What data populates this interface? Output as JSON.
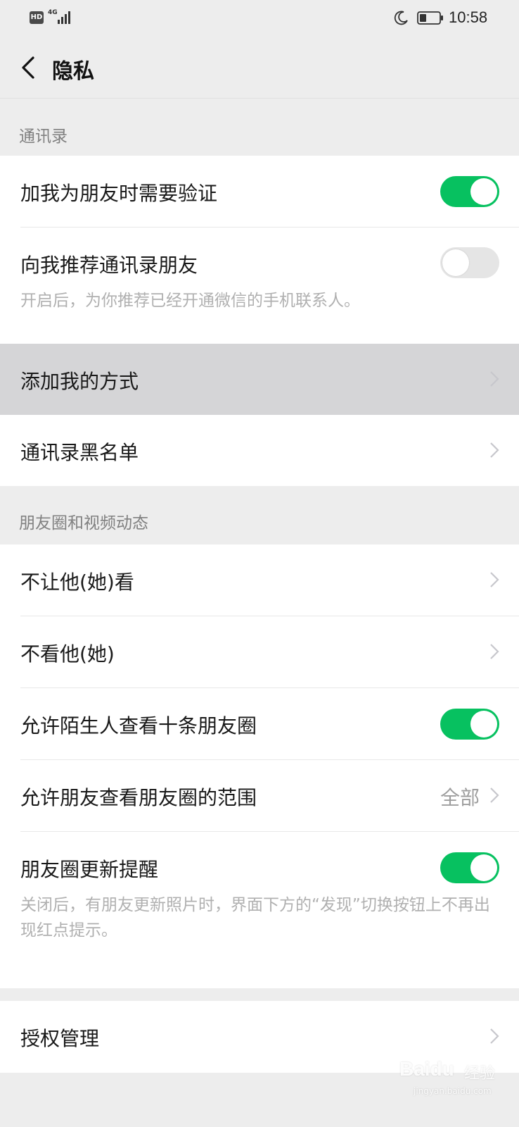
{
  "status_bar": {
    "hd": "HD",
    "network": "4G",
    "time": "10:58"
  },
  "navbar": {
    "title": "隐私",
    "back_icon": "chevron-left-icon"
  },
  "sections": {
    "contacts": {
      "header": "通讯录",
      "items": [
        {
          "label": "加我为朋友时需要验证",
          "toggle": "on"
        },
        {
          "label": "向我推荐通讯录朋友",
          "toggle": "off",
          "description": "开启后，为你推荐已经开通微信的手机联系人。"
        },
        {
          "label": "添加我的方式"
        },
        {
          "label": "通讯录黑名单"
        }
      ]
    },
    "moments": {
      "header": "朋友圈和视频动态",
      "items": [
        {
          "label": "不让他(她)看"
        },
        {
          "label": "不看他(她)"
        },
        {
          "label": "允许陌生人查看十条朋友圈",
          "toggle": "on"
        },
        {
          "label": "允许朋友查看朋友圈的范围",
          "value": "全部"
        },
        {
          "label": "朋友圈更新提醒",
          "toggle": "on",
          "description": "关闭后，有朋友更新照片时，界面下方的“发现”切换按钮上不再出现红点提示。"
        }
      ]
    },
    "auth": {
      "items": [
        {
          "label": "授权管理"
        }
      ]
    }
  },
  "colors": {
    "toggle_on": "#07c160",
    "toggle_off": "#e5e5e5",
    "background": "#ededed",
    "pressed_row": "#d5d5d7"
  },
  "watermark": {
    "main": "Baidu",
    "cn": "经验",
    "sub": "jingyan.baidu.com"
  }
}
